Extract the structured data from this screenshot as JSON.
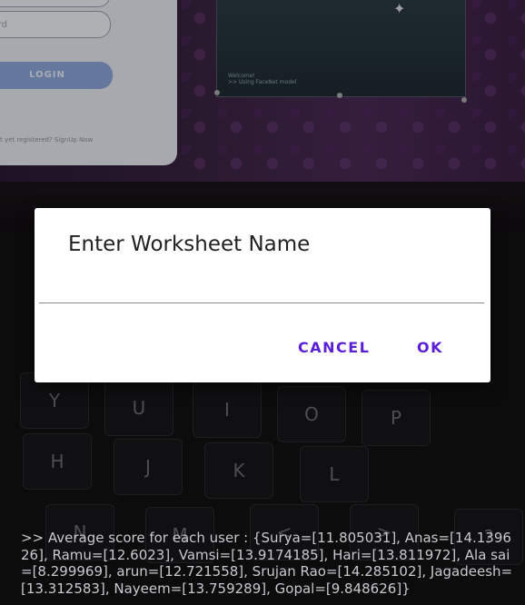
{
  "background": {
    "login_form": {
      "password_placeholder": "ssword",
      "login_button": "LOGIN",
      "signup_text": "t yet registered? SignUp Now"
    },
    "web_window": {
      "message_line1": "Welcome!",
      "message_line2": ">> Using FaceNet model"
    },
    "keyboard_keys": [
      "Y",
      "U",
      "I",
      "O",
      "P",
      "H",
      "J",
      "K",
      "L",
      "N",
      "M",
      "<",
      ">",
      "?"
    ]
  },
  "dialog": {
    "title": "Enter Worksheet Name",
    "input_value": "",
    "cancel_label": "CANCEL",
    "ok_label": "OK"
  },
  "console": {
    "output": ">> Average score for each user : {Surya=[11.805031], Anas=[14.139626], Ramu=[12.6023], Vamsi=[13.9174185], Hari=[13.811972], Ala sai=[8.299969], arun=[12.721558], Srujan Rao=[14.285102], Jagadeesh=[13.312583], Nayeem=[13.759289], Gopal=[9.848626]}"
  },
  "colors": {
    "accent": "#5a1fd6",
    "dialog_bg": "#ffffff",
    "title_text": "#212121"
  }
}
